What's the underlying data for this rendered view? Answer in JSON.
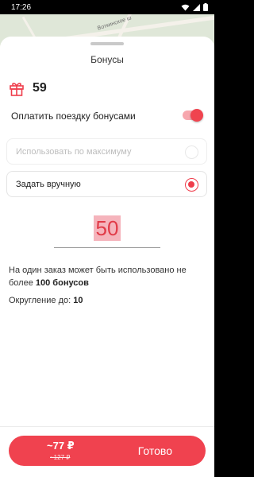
{
  "status_bar": {
    "time": "17:26"
  },
  "map": {
    "street_label": "Воткинское ш"
  },
  "sheet": {
    "title": "Бонусы",
    "bonus_count": "59",
    "pay_with_bonuses_label": "Оплатить поездку бонусами",
    "pay_with_bonuses_enabled": true
  },
  "options": [
    {
      "label": "Использовать по максимуму",
      "selected": false,
      "disabled": true
    },
    {
      "label": "Задать вручную",
      "selected": true,
      "disabled": false
    }
  ],
  "amount": {
    "value": "50"
  },
  "info": {
    "text_before": "На один заказ может быть использовано не более ",
    "max_bonus": "100 бонусов",
    "rounding_label": "Округление до: ",
    "rounding_value": "10"
  },
  "footer": {
    "price": "~77 ₽",
    "old_price": "~127 ₽",
    "done_label": "Готово"
  },
  "colors": {
    "accent": "#f0424f",
    "toggle_track": "#f7a7ae",
    "amount_highlight": "#f5b4bc"
  },
  "icons": [
    "wifi-icon",
    "signal-icon",
    "battery-icon",
    "gift-icon"
  ]
}
